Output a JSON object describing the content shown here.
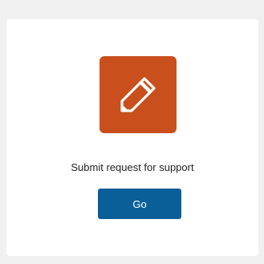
{
  "card": {
    "icon": "pencil-icon",
    "icon_tile_color": "#c9501c",
    "caption": "Submit request for support",
    "button_label": "Go",
    "button_color": "#0b5f98"
  }
}
